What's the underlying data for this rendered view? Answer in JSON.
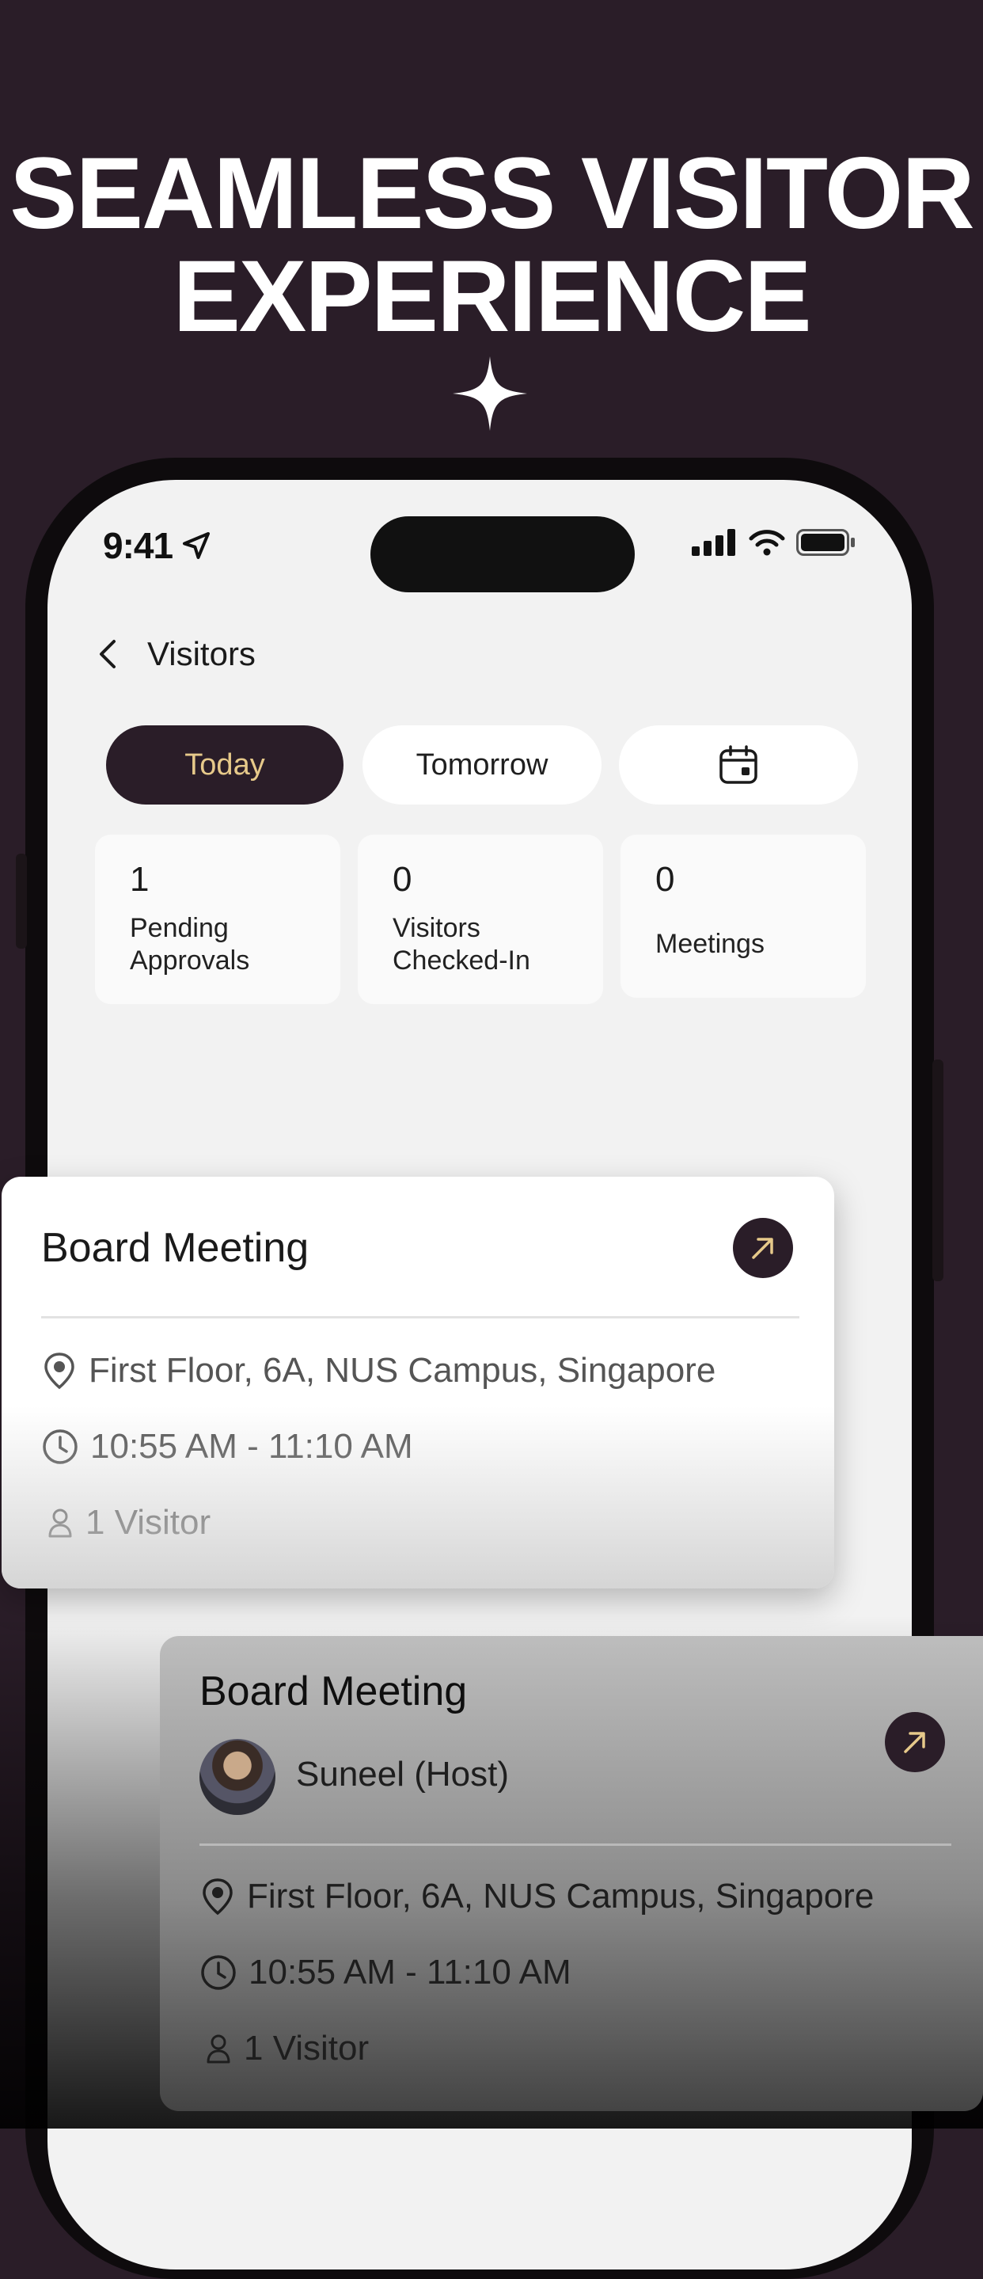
{
  "headline": {
    "line1": "SEAMLESS VISITOR",
    "line2": "EXPERIENCE"
  },
  "status_bar": {
    "time": "9:41"
  },
  "nav": {
    "title": "Visitors"
  },
  "segments": {
    "today": "Today",
    "tomorrow": "Tomorrow",
    "calendar_icon": "calendar-icon"
  },
  "stats": [
    {
      "value": "1",
      "label_line1": "Pending",
      "label_line2": "Approvals"
    },
    {
      "value": "0",
      "label_line1": "Visitors",
      "label_line2": "Checked-In"
    },
    {
      "value": "0",
      "label_line1": "",
      "label_line2": "Meetings"
    }
  ],
  "meeting_card": {
    "title": "Board Meeting",
    "location": "First Floor, 6A, NUS Campus, Singapore",
    "time": "10:55 AM - 11:10 AM",
    "visitors": "1 Visitor"
  },
  "meeting_card_2": {
    "title": "Board Meeting",
    "host": "Suneel (Host)",
    "location": "First Floor, 6A, NUS Campus, Singapore",
    "time": "10:55 AM - 11:10 AM",
    "visitors": "1 Visitor"
  },
  "colors": {
    "background": "#2a1d28",
    "accent": "#e6c98a",
    "screen": "#f2f2f2"
  }
}
